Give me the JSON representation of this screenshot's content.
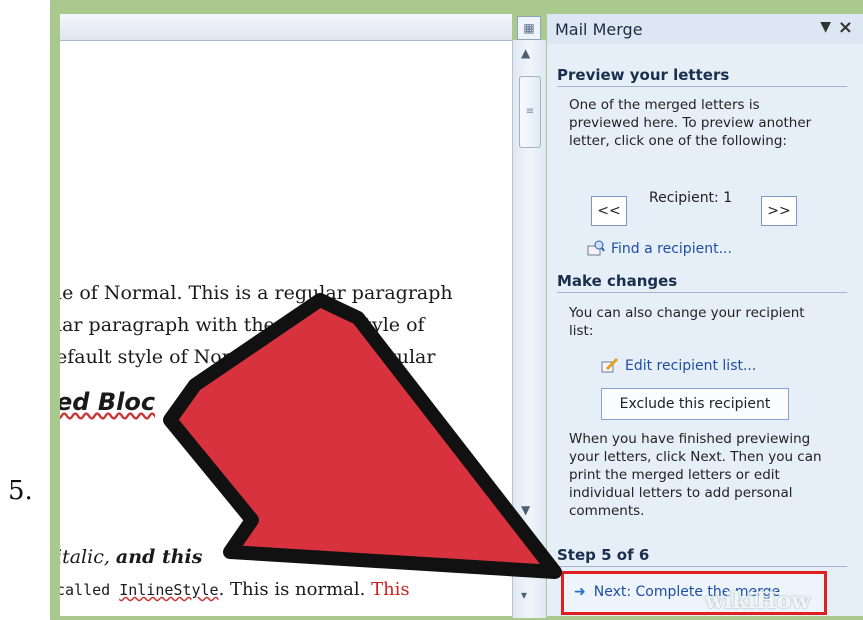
{
  "step_number": "5.",
  "document": {
    "lines": [
      "le of Normal. This is a regular paragraph",
      "lar paragraph with the default style of",
      "efault style of Normal. This is a regular"
    ],
    "heading": "ed Bloc",
    "italic_text": "italic, ",
    "bold_italic_text": "and this",
    "code_line_prefix": "called ",
    "code_line_code": "InlineStyle",
    "code_line_middle": ". This is normal. ",
    "code_line_red": "This"
  },
  "task_pane": {
    "title": "Mail Merge",
    "menu_icon": "dropdown-triangle",
    "close_label": "×",
    "preview_section": {
      "title": "Preview your letters",
      "description": "One of the merged letters is previewed here. To preview another letter, click one of the following:",
      "prev_label": "<<",
      "recipient_label": "Recipient: 1",
      "next_label": ">>",
      "find_label": "Find a recipient..."
    },
    "changes_section": {
      "title": "Make changes",
      "description": "You can also change your recipient list:",
      "edit_label": "Edit recipient list...",
      "exclude_label": "Exclude this recipient",
      "finish_description": "When you have finished previewing your letters, click Next. Then you can print the merged letters or edit individual letters to add personal comments."
    },
    "step_label": "Step 5 of 6",
    "next_label": "Next: Complete the merge"
  },
  "watermark": "wikiHow",
  "colors": {
    "frame": "#aac98e",
    "pane": "#e6eef8",
    "highlight": "#e02020",
    "arrow_fill": "#d8323e"
  }
}
